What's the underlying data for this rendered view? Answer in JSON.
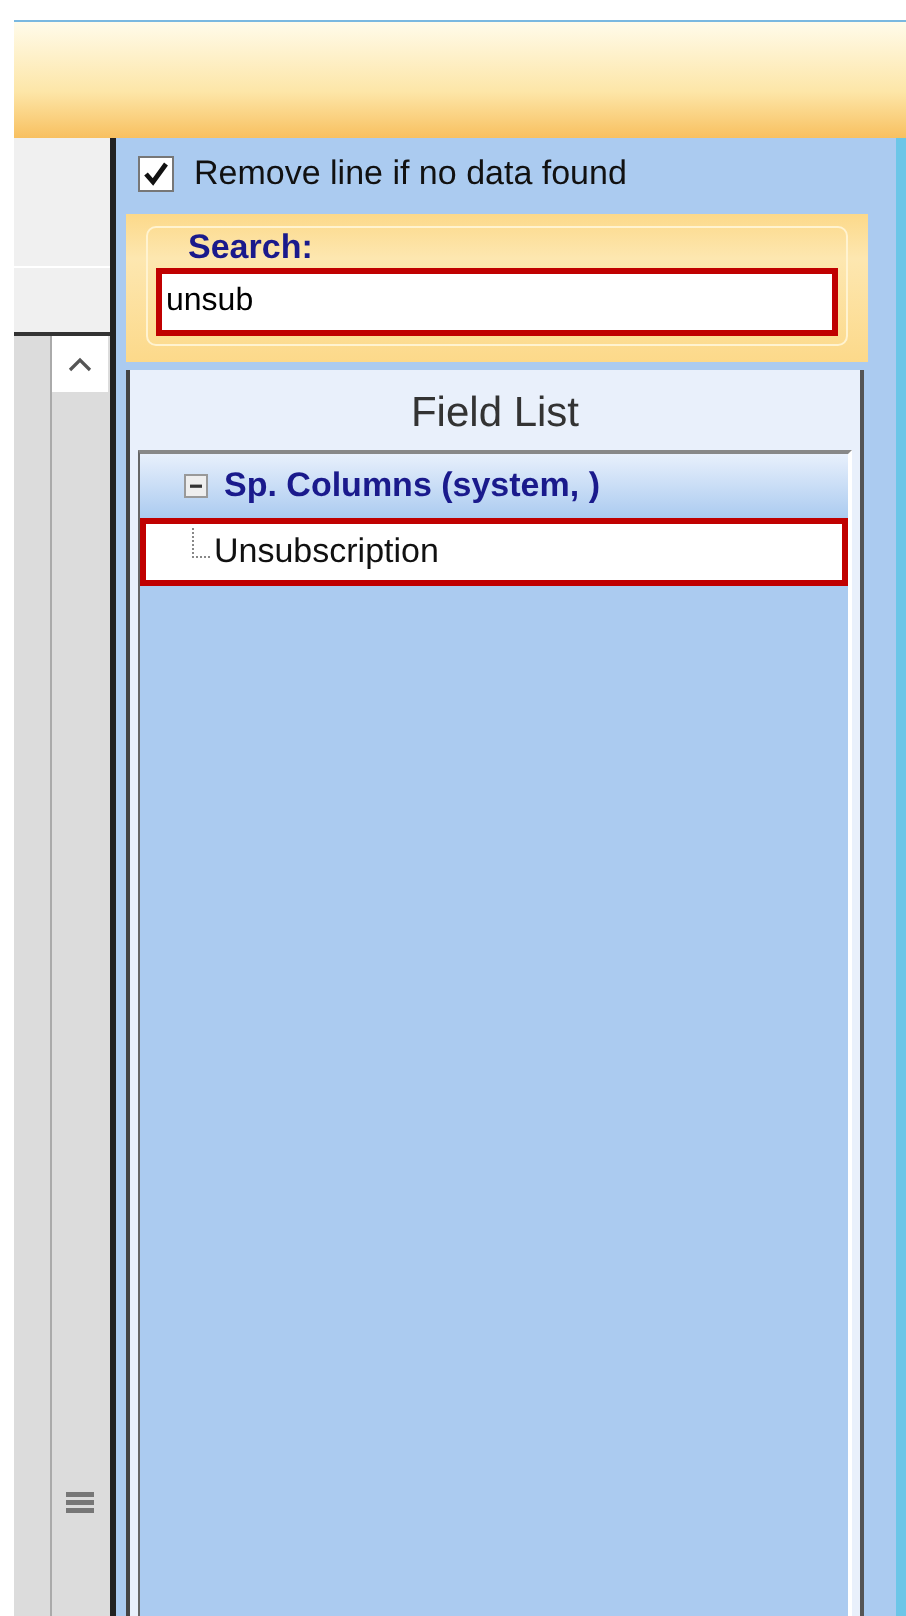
{
  "options": {
    "remove_line_checkbox": {
      "label": "Remove line if no data found",
      "checked": true
    }
  },
  "search": {
    "label": "Search:",
    "value": "unsub"
  },
  "field_list": {
    "title": "Field List",
    "groups": [
      {
        "label": "Sp. Columns (system, )",
        "expanded": true,
        "children": [
          {
            "label": "Unsubscription",
            "selected": true
          }
        ]
      }
    ]
  }
}
